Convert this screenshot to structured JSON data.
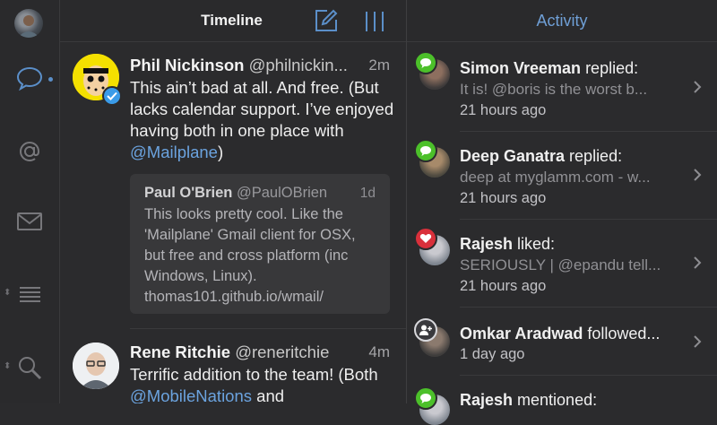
{
  "header": {
    "title": "Timeline"
  },
  "activity_header": {
    "title": "Activity"
  },
  "tweets": [
    {
      "name": "Phil Nickinson",
      "handle": "@philnickin...",
      "time": "2m",
      "text_parts": [
        "This ain’t bad at all. And free. (But lacks calendar support. I’ve enjoyed having both in one place with ",
        "@Mailplane",
        ")"
      ],
      "quote": {
        "name": "Paul O'Brien",
        "handle": "@PaulOBrien",
        "time": "1d",
        "text": "This looks pretty cool. Like the 'Mailplane' Gmail client for OSX, but free and cross platform (inc Windows, Linux). thomas101.github.io/wmail/"
      }
    },
    {
      "name": "Rene Ritchie",
      "handle": "@reneritchie",
      "time": "4m",
      "text_parts": [
        "Terrific addition to the team! (Both ",
        "@MobileNations",
        " and"
      ]
    }
  ],
  "activity": [
    {
      "name": "Simon Vreeman",
      "action": " replied:",
      "detail": "It is! @boris is the worst b...",
      "time": "21 hours ago",
      "badge": "reply",
      "badge_color": "#4cc02a"
    },
    {
      "name": "Deep Ganatra",
      "action": " replied:",
      "detail": "deep at myglamm.com - w...",
      "time": "21 hours ago",
      "badge": "reply",
      "badge_color": "#4cc02a"
    },
    {
      "name": "Rajesh",
      "action": " liked:",
      "detail": "SERIOUSLY | @epandu tell...",
      "time": "21 hours ago",
      "badge": "heart",
      "badge_color": "#d9303b"
    },
    {
      "name": "Omkar Aradwad",
      "action": " followed...",
      "detail": "",
      "time": "1 day ago",
      "badge": "follow",
      "badge_color": "#3a3a3e"
    },
    {
      "name": "Rajesh",
      "action": " mentioned:",
      "detail": "",
      "time": "",
      "badge": "reply",
      "badge_color": "#4cc02a"
    }
  ],
  "colors": {
    "accent": "#6ba3df",
    "background": "#2b2b2d",
    "reply_badge": "#4cc02a",
    "like_badge": "#d9303b"
  },
  "rail_icons": [
    "chat-bubble-icon",
    "at-sign-icon",
    "envelope-icon",
    "list-icon",
    "search-icon"
  ]
}
